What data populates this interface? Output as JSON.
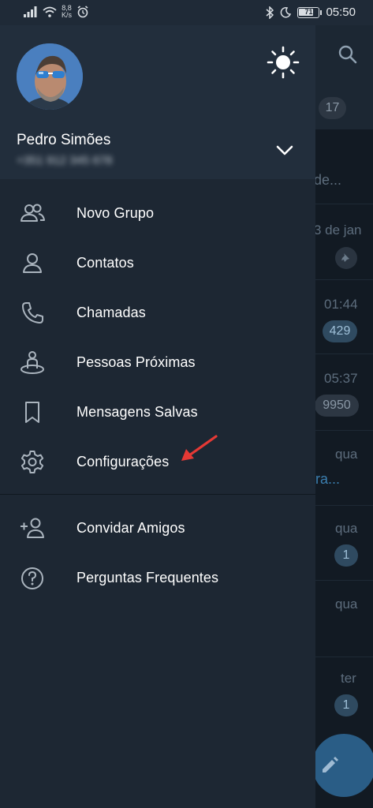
{
  "status_bar": {
    "net_speed_value": "8,8",
    "net_speed_unit": "K/s",
    "battery": "71",
    "time": "05:50"
  },
  "drawer": {
    "profile": {
      "name": "Pedro Simões",
      "phone": "+351 912 345 678"
    },
    "menu_primary": [
      {
        "label": "Novo Grupo",
        "icon": "group-icon"
      },
      {
        "label": "Contatos",
        "icon": "person-icon"
      },
      {
        "label": "Chamadas",
        "icon": "phone-icon"
      },
      {
        "label": "Pessoas Próximas",
        "icon": "people-nearby-icon"
      },
      {
        "label": "Mensagens Salvas",
        "icon": "bookmark-icon"
      },
      {
        "label": "Configurações",
        "icon": "gear-icon"
      }
    ],
    "menu_secondary": [
      {
        "label": "Convidar Amigos",
        "icon": "add-person-icon"
      },
      {
        "label": "Perguntas Frequentes",
        "icon": "help-icon"
      }
    ]
  },
  "background_chat_list": {
    "header_badge": "17",
    "rows": [
      {
        "preview": "de..."
      },
      {
        "time": "3 de jan"
      },
      {
        "time": "01:44",
        "badge": "429"
      },
      {
        "time": "05:37",
        "badge": "9950"
      },
      {
        "time": "qua",
        "preview": "ra..."
      },
      {
        "time": "qua",
        "badge": "1"
      },
      {
        "time": "qua"
      },
      {
        "time": "ter",
        "badge": "1"
      }
    ]
  },
  "colors": {
    "drawer_bg": "#1d2733",
    "drawer_header_bg": "#222e3c",
    "annotation_arrow": "#e53935",
    "accent": "#2a5d86"
  }
}
